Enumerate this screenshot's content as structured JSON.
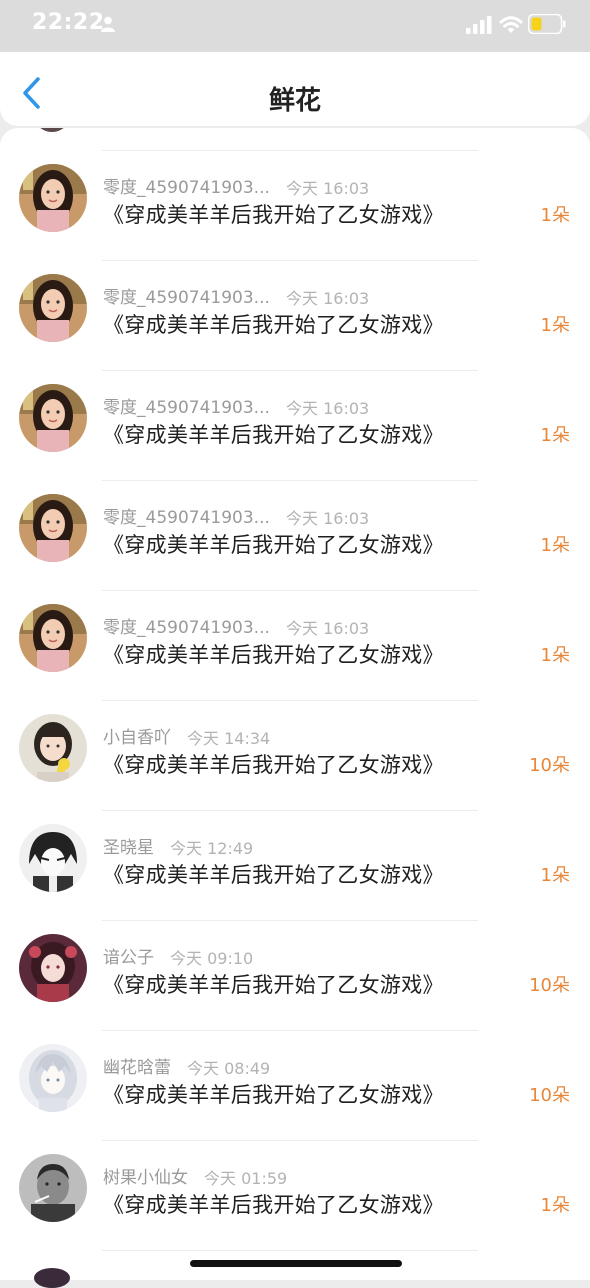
{
  "status_bar": {
    "time": "22:22"
  },
  "navbar": {
    "title": "鲜花"
  },
  "items": [
    {
      "name": "零度_4590741903...",
      "time": "今天 16:03",
      "book": "《穿成美羊羊后我开始了乙女游戏》",
      "count": "1朵",
      "avatar": "girl"
    },
    {
      "name": "零度_4590741903...",
      "time": "今天 16:03",
      "book": "《穿成美羊羊后我开始了乙女游戏》",
      "count": "1朵",
      "avatar": "girl"
    },
    {
      "name": "零度_4590741903...",
      "time": "今天 16:03",
      "book": "《穿成美羊羊后我开始了乙女游戏》",
      "count": "1朵",
      "avatar": "girl"
    },
    {
      "name": "零度_4590741903...",
      "time": "今天 16:03",
      "book": "《穿成美羊羊后我开始了乙女游戏》",
      "count": "1朵",
      "avatar": "girl"
    },
    {
      "name": "零度_4590741903...",
      "time": "今天 16:03",
      "book": "《穿成美羊羊后我开始了乙女游戏》",
      "count": "1朵",
      "avatar": "girl"
    },
    {
      "name": "小自香吖",
      "time": "今天 14:34",
      "book": "《穿成美羊羊后我开始了乙女游戏》",
      "count": "10朵",
      "avatar": "flower-girl"
    },
    {
      "name": "圣晓星",
      "time": "今天 12:49",
      "book": "《穿成美羊羊后我开始了乙女游戏》",
      "count": "1朵",
      "avatar": "anime-bw"
    },
    {
      "name": "谙公子",
      "time": "今天 09:10",
      "book": "《穿成美羊羊后我开始了乙女游戏》",
      "count": "10朵",
      "avatar": "anime-red"
    },
    {
      "name": "幽花晗蕾",
      "time": "今天 08:49",
      "book": "《穿成美羊羊后我开始了乙女游戏》",
      "count": "10朵",
      "avatar": "anime-white"
    },
    {
      "name": "树果小仙女",
      "time": "今天 01:59",
      "book": "《穿成美羊羊后我开始了乙女游戏》",
      "count": "1朵",
      "avatar": "man-bw"
    }
  ]
}
